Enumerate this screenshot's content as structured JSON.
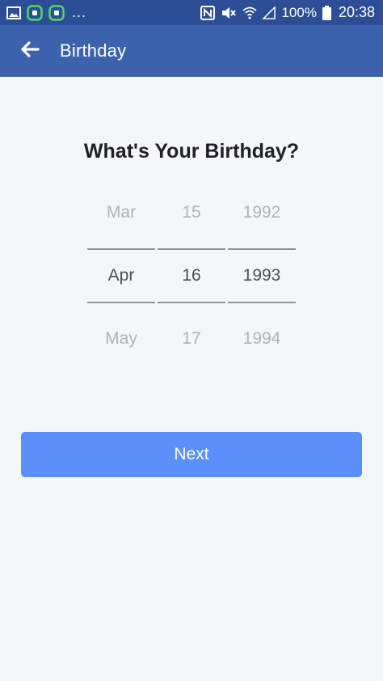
{
  "status_bar": {
    "left_icons": [
      "image-icon",
      "app-notification-icon",
      "app-notification-icon"
    ],
    "overflow": "...",
    "right_icons": [
      "nfc-icon",
      "mute-icon",
      "wifi-icon",
      "signal-icon",
      "battery-icon"
    ],
    "battery": "100%",
    "time": "20:38"
  },
  "app_bar": {
    "back_icon": "arrow-left-icon",
    "title": "Birthday"
  },
  "main": {
    "heading": "What's Your Birthday?",
    "picker": {
      "month": {
        "prev": "Mar",
        "selected": "Apr",
        "next": "May"
      },
      "day": {
        "prev": "15",
        "selected": "16",
        "next": "17"
      },
      "year": {
        "prev": "1992",
        "selected": "1993",
        "next": "1994"
      }
    },
    "next_label": "Next"
  },
  "colors": {
    "status_bar": "#2c4e96",
    "app_bar": "#3d62ad",
    "background": "#f5f6f8",
    "button": "#5b8ff9",
    "accent_green": "#4cd964"
  }
}
